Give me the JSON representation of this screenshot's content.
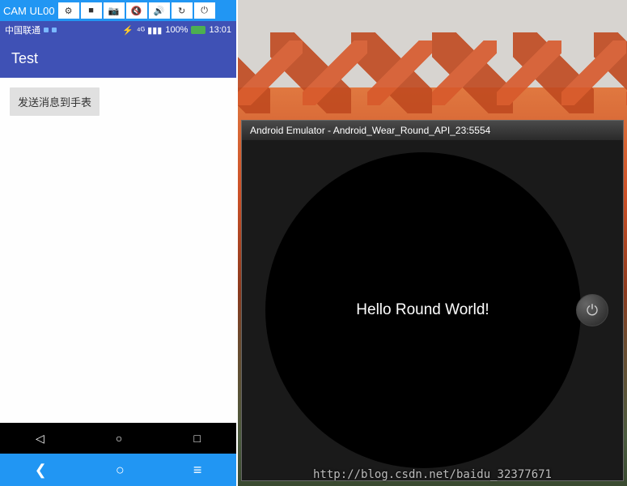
{
  "phone": {
    "topbar_label": "CAM UL00",
    "controls": {
      "settings": "⚙",
      "video": "■",
      "camera": "📷",
      "vol_down": "🔇",
      "vol_up": "🔊",
      "rotate": "↻",
      "power": "⏻"
    },
    "status": {
      "carrier": "中国联通",
      "bt": "⚡",
      "signal": "⁴ᴳ ▮▮▮",
      "battery_pct": "100%",
      "time": "13:01"
    },
    "app_title": "Test",
    "send_button": "发送消息到手表",
    "softkeys": {
      "back": "◁",
      "home": "○",
      "recent": "□"
    },
    "bottombar": {
      "back": "❮",
      "home": "○",
      "menu": "≡"
    }
  },
  "wear": {
    "window_title": "Android Emulator - Android_Wear_Round_API_23:5554",
    "screen_text": "Hello Round World!",
    "power_icon": "⏻"
  },
  "watermark": "http://blog.csdn.net/baidu_32377671"
}
